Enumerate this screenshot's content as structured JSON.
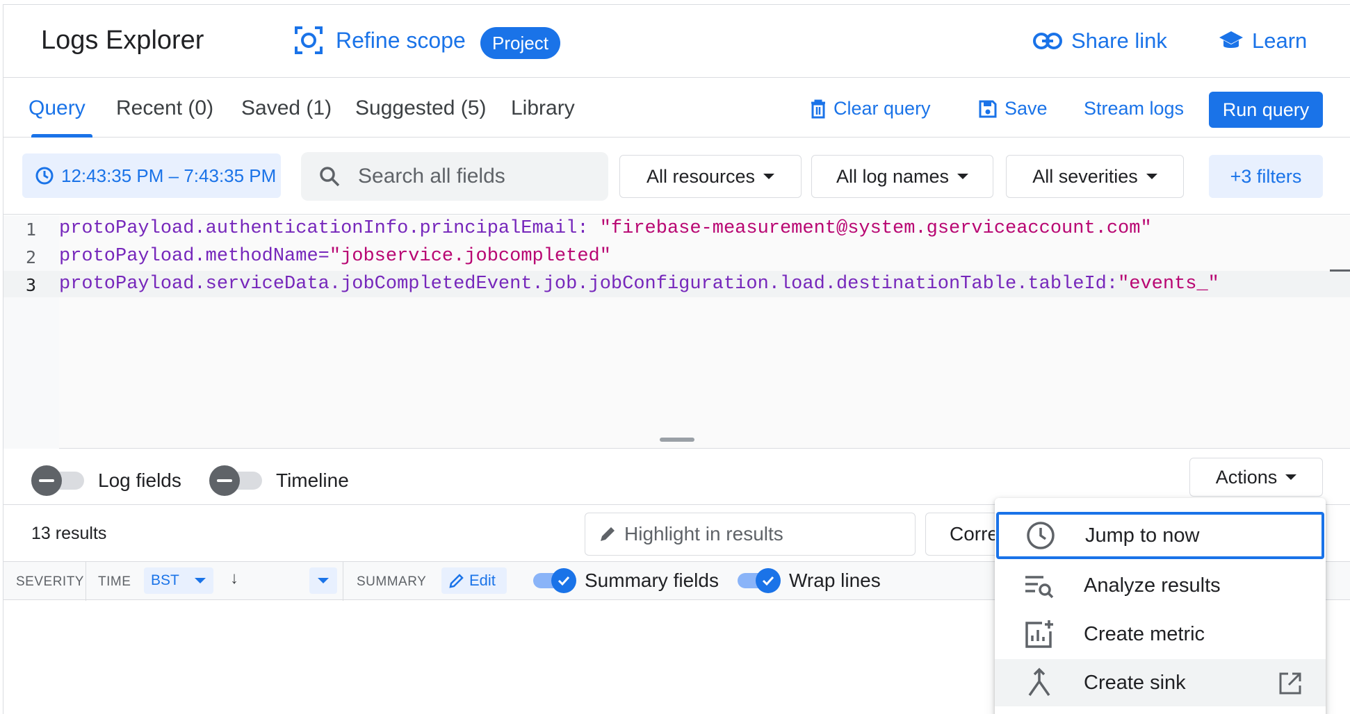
{
  "header": {
    "title": "Logs Explorer",
    "refine_scope": "Refine scope",
    "scope_badge": "Project",
    "share_link": "Share link",
    "learn": "Learn"
  },
  "tabs": [
    {
      "label": "Query",
      "active": true
    },
    {
      "label": "Recent (0)"
    },
    {
      "label": "Saved (1)"
    },
    {
      "label": "Suggested (5)"
    },
    {
      "label": "Library"
    }
  ],
  "toolbar": {
    "clear_query": "Clear query",
    "save": "Save",
    "stream_logs": "Stream logs",
    "run_query": "Run query"
  },
  "filters": {
    "time_range": "12:43:35 PM – 7:43:35 PM",
    "search_placeholder": "Search all fields",
    "resources": "All resources",
    "log_names": "All log names",
    "severities": "All severities",
    "more_filters": "+3 filters"
  },
  "editor": {
    "lines": [
      {
        "num": "1",
        "key": "protoPayload.authenticationInfo.principalEmail",
        "op": ": ",
        "value": "\"firebase-measurement@system.gserviceaccount.com\""
      },
      {
        "num": "2",
        "key": "protoPayload.methodName",
        "op": "=",
        "value": "\"jobservice.jobcompleted\""
      },
      {
        "num": "3",
        "key": "protoPayload.serviceData.jobCompletedEvent.job.jobConfiguration.load.destinationTable.tableId",
        "op": ":",
        "value": "\"events_\""
      }
    ]
  },
  "panels": {
    "log_fields": "Log fields",
    "timeline": "Timeline",
    "actions": "Actions"
  },
  "results": {
    "count": "13 results",
    "highlight_placeholder": "Highlight in results",
    "correlate": "Corre"
  },
  "columns": {
    "severity": "SEVERITY",
    "time": "TIME",
    "timezone": "BST",
    "summary": "SUMMARY",
    "edit": "Edit",
    "summary_fields": "Summary fields",
    "wrap_lines": "Wrap lines"
  },
  "menu": {
    "items": [
      {
        "label": "Jump to now",
        "icon": "clock-icon"
      },
      {
        "label": "Analyze results",
        "icon": "analyze-icon"
      },
      {
        "label": "Create metric",
        "icon": "metric-icon"
      },
      {
        "label": "Create sink",
        "icon": "merge-icon"
      }
    ]
  },
  "colors": {
    "accent": "#1a73e8",
    "key": "#7627bb",
    "string": "#b80672"
  }
}
